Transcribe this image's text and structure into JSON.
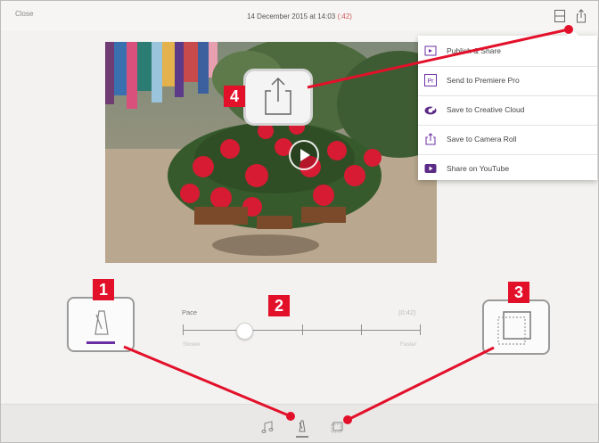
{
  "topbar": {
    "close_label": "Close",
    "title": "14 December 2015 at 14:03",
    "duration": "(:42)"
  },
  "share_menu": {
    "items": [
      {
        "label": "Publish & Share",
        "icon": "publish-icon"
      },
      {
        "label": "Send to Premiere Pro",
        "icon": "premiere-pro-icon",
        "icon_text": "Pr"
      },
      {
        "label": "Save to Creative Cloud",
        "icon": "creative-cloud-icon"
      },
      {
        "label": "Save to Camera Roll",
        "icon": "camera-roll-icon"
      },
      {
        "label": "Share on YouTube",
        "icon": "youtube-icon"
      }
    ]
  },
  "pace": {
    "label": "Pace",
    "time": "(0:42)",
    "slower_label": "Slower",
    "faster_label": "Faster",
    "level": 0.26
  },
  "callouts": {
    "one": "1",
    "two": "2",
    "three": "3",
    "four": "4"
  },
  "colors": {
    "callout_red": "#e3102a",
    "accent_purple": "#6b2fa3",
    "youtube_purple": "#5b2a86",
    "duration_red": "#d05b5b"
  }
}
